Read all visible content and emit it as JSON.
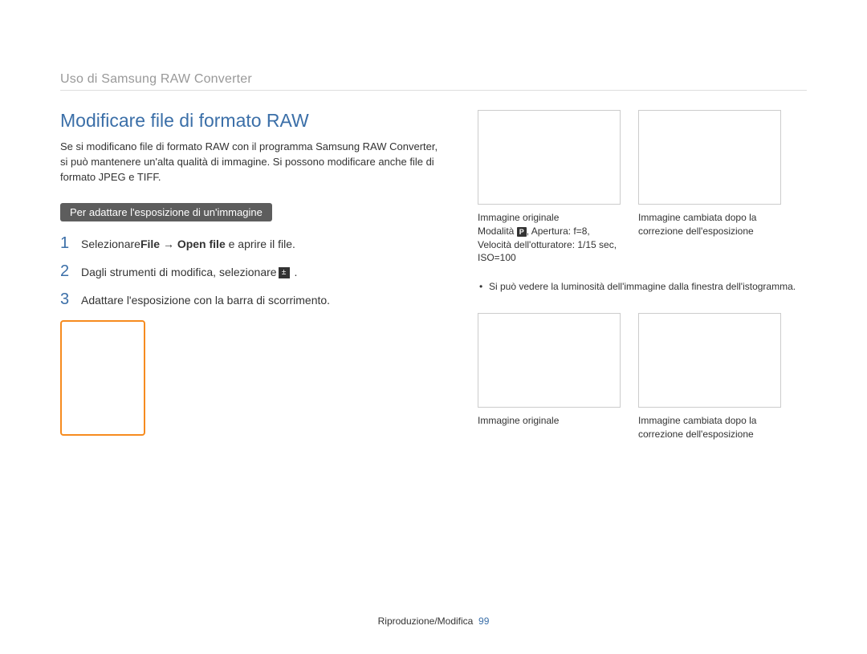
{
  "breadcrumb": "Uso di Samsung RAW Converter",
  "title": "Modiﬁcare ﬁle di formato RAW",
  "intro": "Se si modificano file di formato RAW con il programma Samsung RAW Converter, si può mantenere un'alta qualità di immagine. Si possono modificare anche file di formato JPEG e TIFF.",
  "pill": "Per adattare l'esposizione di un'immagine",
  "steps": [
    {
      "num": "1",
      "pre": "Selezionare",
      "bold": "File → Open ﬁle",
      "post": " e aprire il ﬁle."
    },
    {
      "num": "2",
      "pre": "Dagli strumenti di modiﬁca, selezionare",
      "icon": true,
      "post": " ."
    },
    {
      "num": "3",
      "pre": "Adattare l'esposizione con la barra di scorrimento.",
      "post": ""
    }
  ],
  "captions_top": {
    "left_line1": "Immagine originale",
    "left_line2_pre": "Modalità ",
    "left_line2_mode": "P",
    "left_line2_post": ", Apertura: f=8,",
    "left_line3": "Velocità dell'otturatore: 1/15 sec,",
    "left_line4": "ISO=100",
    "right_line1": "Immagine cambiata dopo la",
    "right_line2": "correzione dell'esposizione"
  },
  "note": "Si può vedere la luminosità dell'immagine dalla finestra dell'istogramma.",
  "captions_bottom": {
    "left": "Immagine originale",
    "right_line1": "Immagine cambiata dopo la",
    "right_line2": "correzione dell'esposizione"
  },
  "footer_label": "Riproduzione/Modifica",
  "footer_page": "99"
}
